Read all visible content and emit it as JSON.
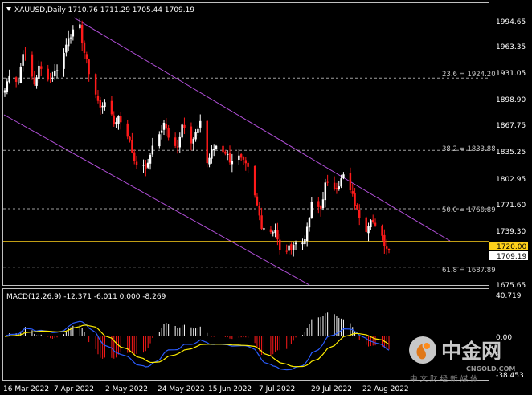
{
  "header": {
    "symbol_line": "XAUUSD,Daily  1710.76 1711.29 1705.44 1709.19"
  },
  "indicator": {
    "label": "MACD(12,26,9) -12.371 -6.011 0.000 -8.269"
  },
  "fib_labels": [
    "23.6 = 1924.20",
    "38.2 = 1833.88",
    "50.0 = 1760.89",
    "61.8 = 1687.89"
  ],
  "price_axis_labels": [
    "1994.65",
    "1963.35",
    "1931.05",
    "1898.90",
    "1867.75",
    "1835.25",
    "1802.95",
    "1771.60",
    "1739.30",
    "1675.65"
  ],
  "price_tags": {
    "level": "1720.00",
    "current": "1709.19"
  },
  "macd_axis_labels": [
    "40.719",
    "0.00",
    "-38.453"
  ],
  "date_labels": [
    "16 Mar 2022",
    "7 Apr 2022",
    "2 May 2022",
    "24 May 2022",
    "15 Jun 2022",
    "7 Jul 2022",
    "29 Jul 2022",
    "22 Aug 2022"
  ],
  "watermark": {
    "brand_cn": "中金网",
    "url": "CNGOLD.COM",
    "subtitle": "中 文 财 经 新 媒 体"
  },
  "colors": {
    "background": "#000000",
    "bull": "#ffffff",
    "bear": "#ff1a1a",
    "channel": "#b14fd8",
    "level_line": "#ffd11a",
    "grid": "#c8c8c8",
    "macd_line": "#2a5cff",
    "signal_line": "#ffee00"
  },
  "chart_data": {
    "type": "candlestick",
    "symbol": "XAUUSD",
    "timeframe": "Daily",
    "last_bar": {
      "open": 1710.76,
      "high": 1711.29,
      "low": 1705.44,
      "close": 1709.19
    },
    "price_range": [
      1670,
      2005
    ],
    "x_tick_labels": [
      "16 Mar 2022",
      "7 Apr 2022",
      "2 May 2022",
      "24 May 2022",
      "15 Jun 2022",
      "7 Jul 2022",
      "29 Jul 2022",
      "22 Aug 2022"
    ],
    "anchors": [
      [
        "2022-03-16",
        1909
      ],
      [
        "2022-03-18",
        1930
      ],
      [
        "2022-03-22",
        1919
      ],
      [
        "2022-03-24",
        1958
      ],
      [
        "2022-03-29",
        1917
      ],
      [
        "2022-03-31",
        1937
      ],
      [
        "2022-04-05",
        1923
      ],
      [
        "2022-04-07",
        1931
      ],
      [
        "2022-04-11",
        1955
      ],
      [
        "2022-04-13",
        1977
      ],
      [
        "2022-04-18",
        1987
      ],
      [
        "2022-04-20",
        1956
      ],
      [
        "2022-04-22",
        1932
      ],
      [
        "2022-04-27",
        1886
      ],
      [
        "2022-04-29",
        1897
      ],
      [
        "2022-05-03",
        1867
      ],
      [
        "2022-05-05",
        1876
      ],
      [
        "2022-05-09",
        1854
      ],
      [
        "2022-05-12",
        1822
      ],
      [
        "2022-05-16",
        1812
      ],
      [
        "2022-05-18",
        1815
      ],
      [
        "2022-05-20",
        1842
      ],
      [
        "2022-05-23",
        1853
      ],
      [
        "2022-05-25",
        1866
      ],
      [
        "2022-05-27",
        1853
      ],
      [
        "2022-05-31",
        1838
      ],
      [
        "2022-06-02",
        1870
      ],
      [
        "2022-06-06",
        1841
      ],
      [
        "2022-06-08",
        1853
      ],
      [
        "2022-06-10",
        1871
      ],
      [
        "2022-06-13",
        1818
      ],
      [
        "2022-06-15",
        1832
      ],
      [
        "2022-06-17",
        1840
      ],
      [
        "2022-06-21",
        1832
      ],
      [
        "2022-06-23",
        1822
      ],
      [
        "2022-06-27",
        1825
      ],
      [
        "2022-06-29",
        1818
      ],
      [
        "2022-07-01",
        1810
      ],
      [
        "2022-07-05",
        1764
      ],
      [
        "2022-07-07",
        1740
      ],
      [
        "2022-07-11",
        1733
      ],
      [
        "2022-07-13",
        1735
      ],
      [
        "2022-07-15",
        1707
      ],
      [
        "2022-07-19",
        1711
      ],
      [
        "2022-07-21",
        1717
      ],
      [
        "2022-07-25",
        1719
      ],
      [
        "2022-07-27",
        1734
      ],
      [
        "2022-07-29",
        1766
      ],
      [
        "2022-08-02",
        1761
      ],
      [
        "2022-08-04",
        1791
      ],
      [
        "2022-08-08",
        1788
      ],
      [
        "2022-08-10",
        1792
      ],
      [
        "2022-08-12",
        1802
      ],
      [
        "2022-08-16",
        1776
      ],
      [
        "2022-08-18",
        1758
      ],
      [
        "2022-08-22",
        1736
      ],
      [
        "2022-08-24",
        1751
      ],
      [
        "2022-08-26",
        1737
      ],
      [
        "2022-08-29",
        1724
      ],
      [
        "2022-08-31",
        1711
      ],
      [
        "2022-09-01",
        1709.19
      ]
    ],
    "fibonacci": [
      {
        "level": 23.6,
        "price": 1924.2
      },
      {
        "level": 38.2,
        "price": 1833.88
      },
      {
        "level": 50.0,
        "price": 1760.89
      },
      {
        "level": 61.8,
        "price": 1687.89
      }
    ],
    "horizontal_level": 1720.0,
    "channel": {
      "upper": [
        [
          "2022-04-18",
          2002
        ],
        [
          "2022-09-07",
          1722
        ]
      ],
      "lower": [
        [
          "2022-03-16",
          1880
        ],
        [
          "2022-07-18",
          1672
        ]
      ]
    },
    "macd": {
      "params": "12,26,9",
      "values": {
        "macd": -12.371,
        "signal": -6.011,
        "zero": 0.0,
        "histogram": -8.269
      },
      "range": [
        -38.453,
        40.719
      ]
    }
  }
}
